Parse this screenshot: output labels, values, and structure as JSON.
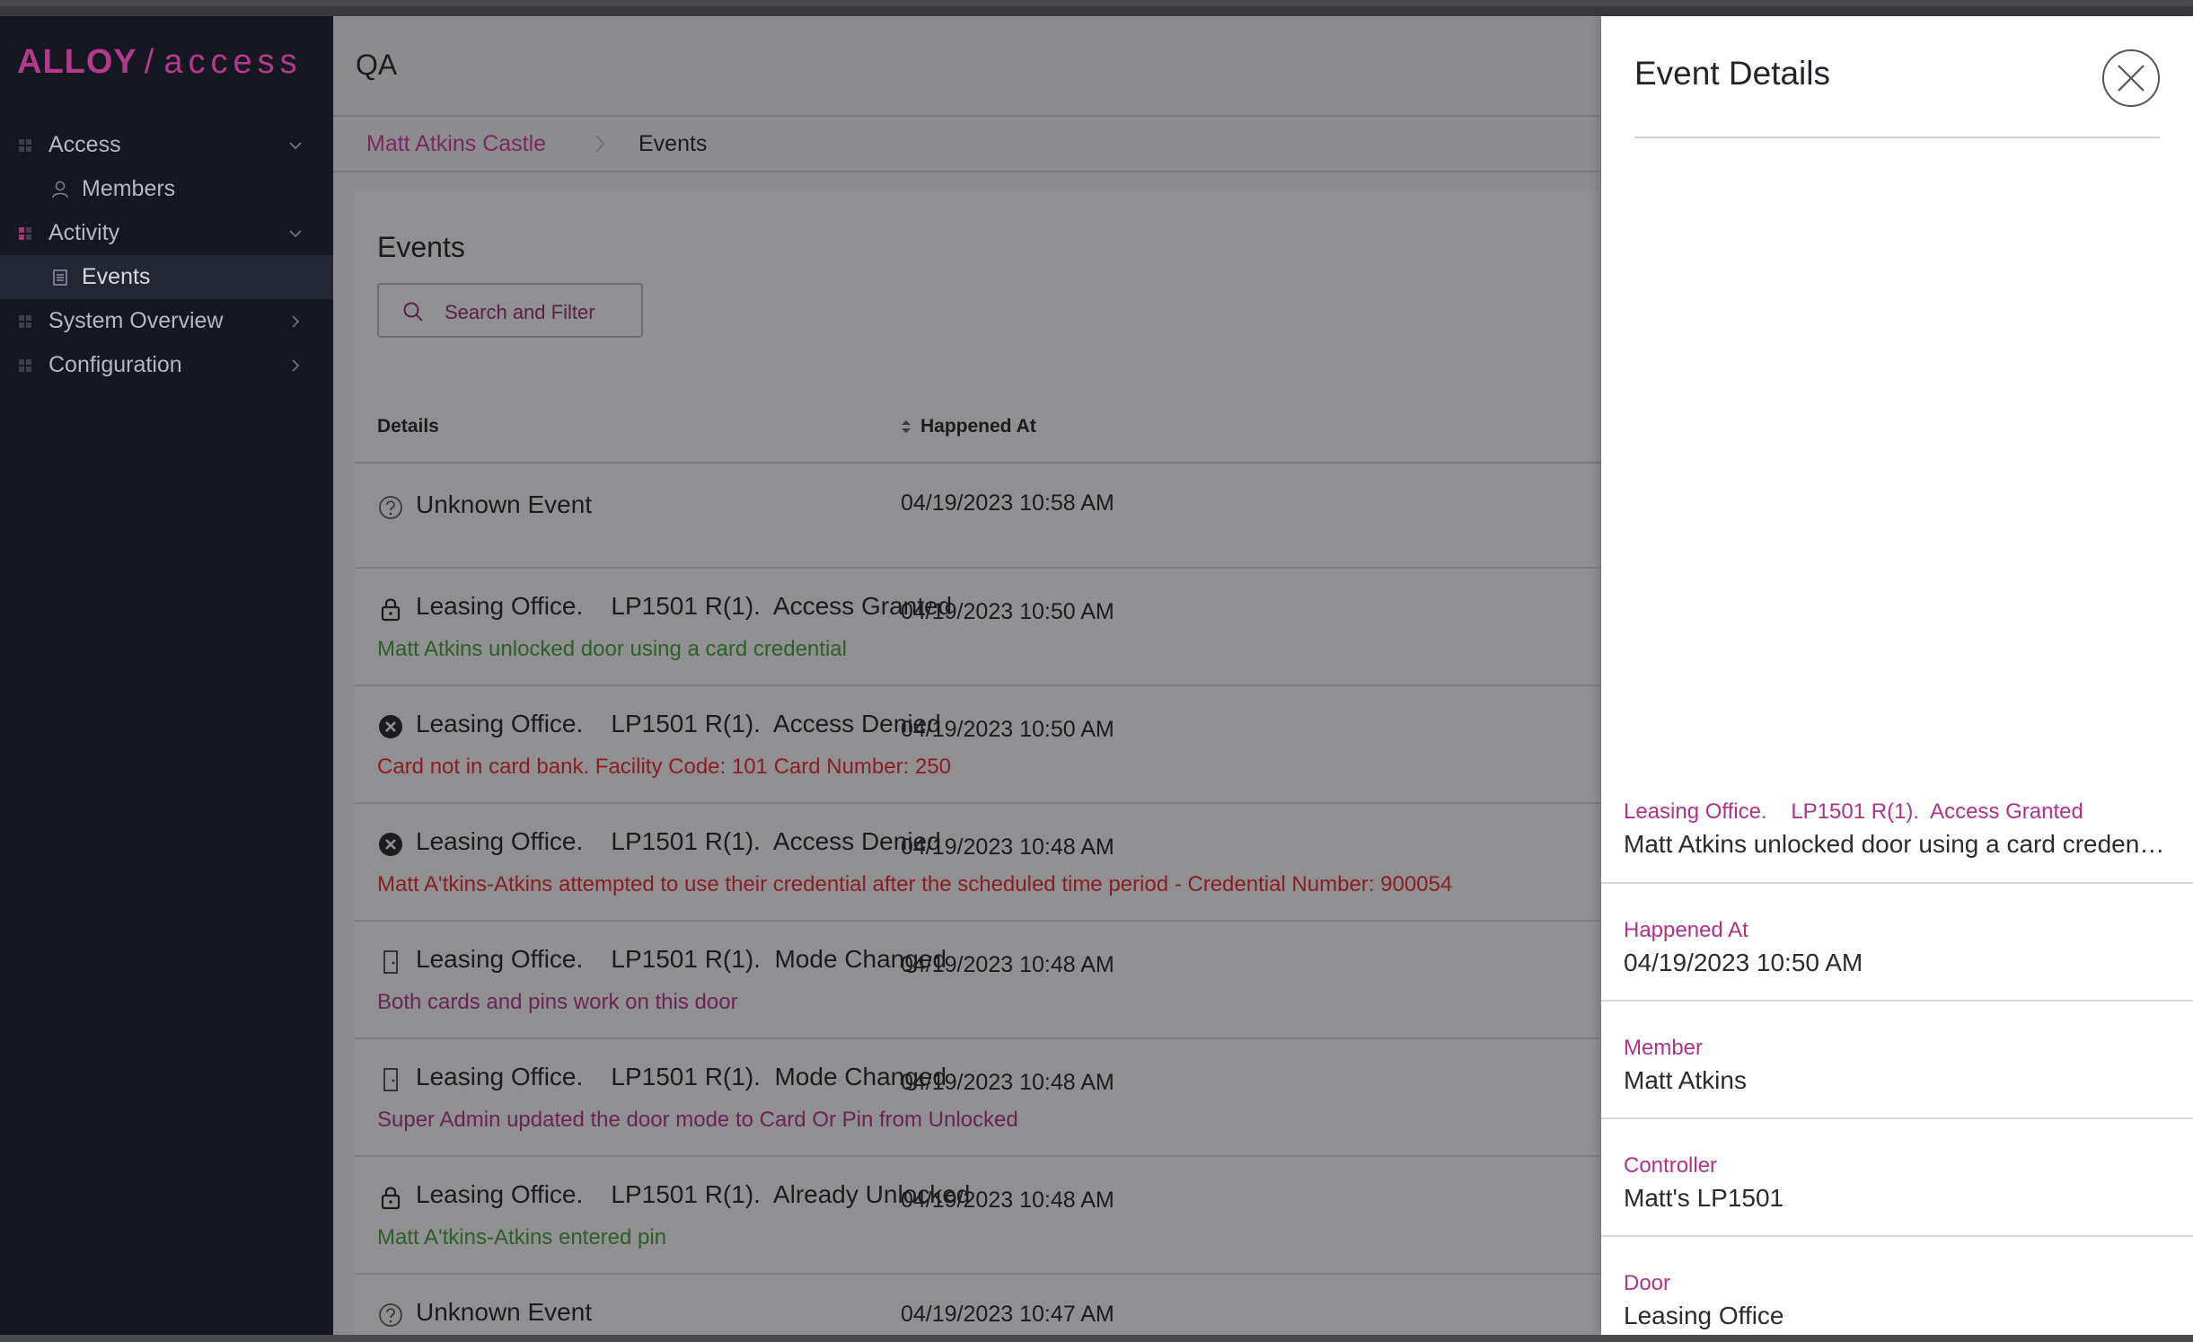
{
  "app": {
    "logo": {
      "brand": "ALLOY",
      "slash": "/",
      "product": "access"
    }
  },
  "sidebar": {
    "items": [
      {
        "label": "Access",
        "type": "section",
        "expanded": true
      },
      {
        "label": "Members",
        "type": "sub"
      },
      {
        "label": "Activity",
        "type": "section",
        "expanded": true
      },
      {
        "label": "Events",
        "type": "sub",
        "active": true
      },
      {
        "label": "System Overview",
        "type": "section",
        "expanded": false
      },
      {
        "label": "Configuration",
        "type": "section",
        "expanded": false
      }
    ]
  },
  "header": {
    "title": "QA"
  },
  "breadcrumb": {
    "parent": "Matt Atkins Castle",
    "separator": ">",
    "current": "Events"
  },
  "events": {
    "title": "Events",
    "search_placeholder": "Search and Filter",
    "columns": {
      "details": "Details",
      "happened_at": "Happened At"
    },
    "rows": [
      {
        "icon": "question-icon",
        "title": "Unknown Event",
        "subtitle": "",
        "subtitle_color": "",
        "time": "04/19/2023 10:58 AM"
      },
      {
        "icon": "lock-icon",
        "title": "Leasing Office.    LP1501 R(1).  Access Granted",
        "subtitle": "Matt Atkins  unlocked door using a card credential",
        "subtitle_color": "#2e5e2a",
        "time": "04/19/2023 10:50 AM"
      },
      {
        "icon": "x-circle-icon",
        "title": "Leasing Office.    LP1501 R(1).  Access Denied",
        "subtitle": "Card not in card bank. Facility Code: 101 Card Number: 250",
        "subtitle_color": "#8a1e24",
        "time": "04/19/2023 10:50 AM"
      },
      {
        "icon": "x-circle-icon",
        "title": "Leasing Office.    LP1501 R(1).  Access Denied",
        "subtitle": "Matt A'tkins-Atkins  attempted to use their credential after the scheduled time period - Credential Number: 900054",
        "subtitle_color": "#8a1e24",
        "time": "04/19/2023 10:48 AM"
      },
      {
        "icon": "door-icon",
        "title": "Leasing Office.    LP1501 R(1).  Mode Changed",
        "subtitle": "Both cards and pins work on this door",
        "subtitle_color": "#6a2456",
        "time": "04/19/2023 10:48 AM"
      },
      {
        "icon": "door-icon",
        "title": "Leasing Office.    LP1501 R(1).  Mode Changed",
        "subtitle": "Super Admin updated the door mode to Card Or Pin from Unlocked",
        "subtitle_color": "#6a2456",
        "time": "04/19/2023 10:48 AM"
      },
      {
        "icon": "lock-icon",
        "title": "Leasing Office.    LP1501 R(1).  Already Unlocked",
        "subtitle": "Matt A'tkins-Atkins  entered pin",
        "subtitle_color": "#2e5e2a",
        "time": "04/19/2023 10:48 AM"
      },
      {
        "icon": "question-icon",
        "title": "Unknown Event",
        "subtitle": "",
        "subtitle_color": "",
        "time": "04/19/2023 10:47 AM"
      }
    ]
  },
  "drawer": {
    "title": "Event Details",
    "fields": [
      {
        "label": "Leasing Office.    LP1501 R(1).  Access Granted",
        "value": "Matt Atkins  unlocked door using a card credential"
      },
      {
        "label": "Happened At",
        "value": "04/19/2023 10:50 AM"
      },
      {
        "label": "Member",
        "value": "Matt Atkins"
      },
      {
        "label": "Controller",
        "value": "Matt's LP1501"
      },
      {
        "label": "Door",
        "value": "Leasing Office"
      }
    ]
  }
}
